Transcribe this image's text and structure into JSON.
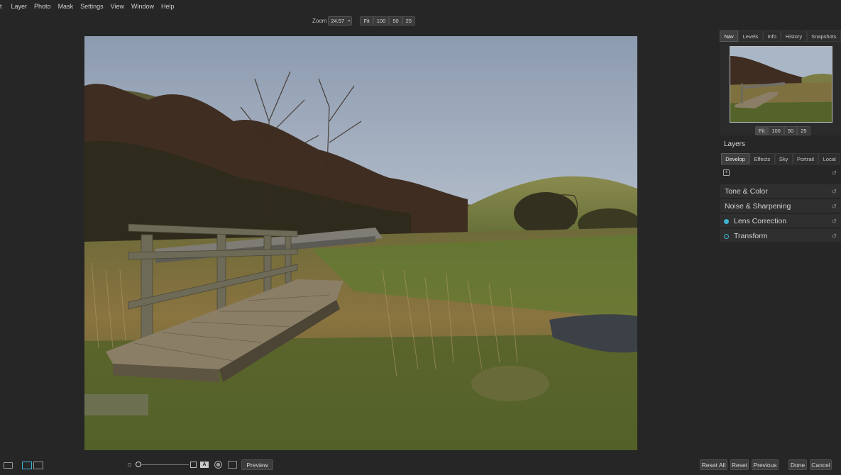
{
  "menu": [
    "t",
    "Layer",
    "Photo",
    "Mask",
    "Settings",
    "View",
    "Window",
    "Help"
  ],
  "zoombar": {
    "label": "Zoom",
    "value": "24.57",
    "presets": [
      "Fit",
      "100",
      "50",
      "25"
    ]
  },
  "panel": {
    "tabs": [
      "Nav",
      "Levels",
      "Info",
      "History",
      "Snapshots"
    ],
    "active_tab": "Nav",
    "nav_presets": [
      "Fit",
      "100",
      "50",
      "25"
    ],
    "layers_title": "Layers",
    "layer_tabs": [
      "Develop",
      "Effects",
      "Sky",
      "Portrait",
      "Local"
    ],
    "active_layer_tab": "Develop",
    "sections": [
      {
        "label": "Tone & Color"
      },
      {
        "label": "Noise & Sharpening"
      },
      {
        "label": "Lens Correction",
        "indicator": "filled"
      },
      {
        "label": "Transform",
        "indicator": "ring"
      }
    ]
  },
  "bottom": {
    "preview_label": "Preview",
    "buttons": [
      "Reset All",
      "Reset",
      "Previous",
      "Done",
      "Cancel"
    ]
  },
  "icons": {
    "reset": "undo-icon",
    "add_layer": "add-layer-icon"
  },
  "colors": {
    "accent": "#3db4d4",
    "background": "#262626"
  }
}
